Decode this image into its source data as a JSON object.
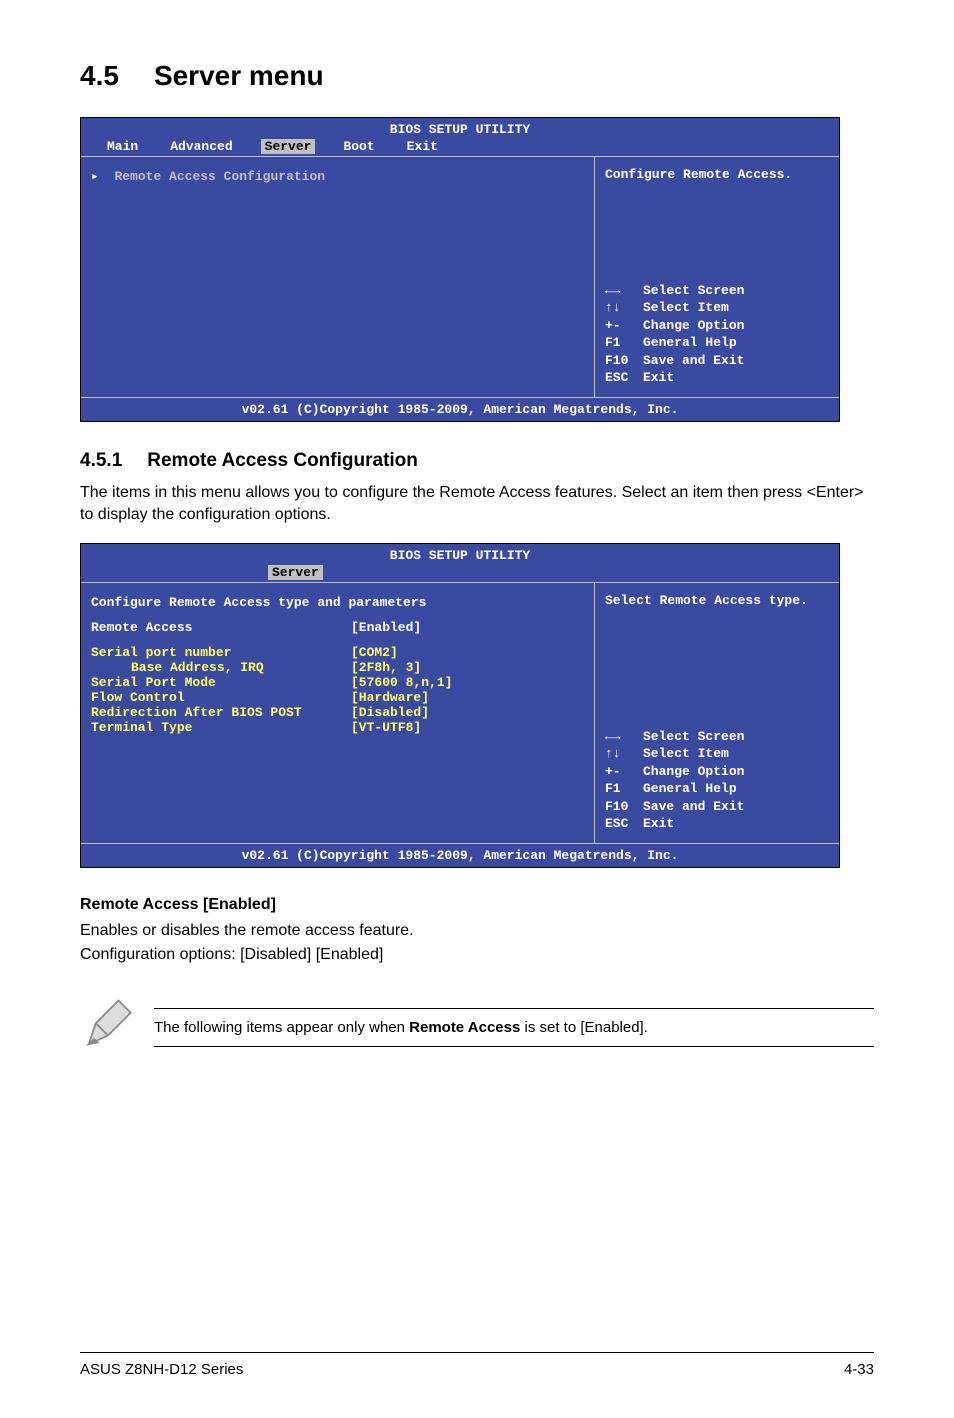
{
  "section": {
    "num": "4.5",
    "title": "Server menu"
  },
  "bios1": {
    "title": "BIOS SETUP UTILITY",
    "menu": [
      "Main",
      "Advanced",
      "Server",
      "Boot",
      "Exit"
    ],
    "active": "Server",
    "left": {
      "item": "Remote Access Configuration"
    },
    "rightTop": "Configure Remote Access.",
    "keys": [
      {
        "k": "←→",
        "d": "Select Screen"
      },
      {
        "k": "↑↓",
        "d": "Select Item"
      },
      {
        "k": "+-",
        "d": "Change Option"
      },
      {
        "k": "F1",
        "d": "General Help"
      },
      {
        "k": "F10",
        "d": "Save and Exit"
      },
      {
        "k": "ESC",
        "d": "Exit"
      }
    ],
    "copyright": "v02.61 (C)Copyright 1985-2009, American Megatrends, Inc."
  },
  "subsection": {
    "num": "4.5.1",
    "title": "Remote Access Configuration"
  },
  "para1": "The items in this menu allows you to configure the Remote Access features. Select an item then press <Enter> to display the configuration options.",
  "bios2": {
    "title": "BIOS SETUP UTILITY",
    "active": "Server",
    "heading": "Configure Remote Access type and parameters",
    "rows": [
      {
        "a": "Remote Access",
        "b": "[Enabled]",
        "yellow": false
      },
      {
        "a": "",
        "b": "",
        "yellow": false
      },
      {
        "a": "Serial port number",
        "b": "[COM2]",
        "yellow": true
      },
      {
        "a": "Base Address, IRQ",
        "b": "[2F8h, 3]",
        "yellow": true,
        "indent": true
      },
      {
        "a": "Serial Port Mode",
        "b": "[57600 8,n,1]",
        "yellow": true
      },
      {
        "a": "Flow Control",
        "b": "[Hardware]",
        "yellow": true
      },
      {
        "a": "Redirection After BIOS POST",
        "b": "[Disabled]",
        "yellow": true
      },
      {
        "a": "Terminal Type",
        "b": "[VT-UTF8]",
        "yellow": true
      }
    ],
    "rightTop": "Select Remote Access type.",
    "keys": [
      {
        "k": "←→",
        "d": "Select Screen"
      },
      {
        "k": "↑↓",
        "d": "Select Item"
      },
      {
        "k": "+-",
        "d": "Change Option"
      },
      {
        "k": "F1",
        "d": "General Help"
      },
      {
        "k": "F10",
        "d": "Save and Exit"
      },
      {
        "k": "ESC",
        "d": "Exit"
      }
    ],
    "copyright": "v02.61 (C)Copyright 1985-2009, American Megatrends, Inc."
  },
  "option": {
    "head": "Remote Access [Enabled]",
    "line1": "Enables or disables the remote access feature.",
    "line2": "Configuration options: [Disabled] [Enabled]"
  },
  "note": {
    "pre": "The following items appear only when ",
    "bold": "Remote Access",
    "post": " is set to [Enabled]."
  },
  "footer": {
    "left": "ASUS Z8NH-D12 Series",
    "right": "4-33"
  }
}
